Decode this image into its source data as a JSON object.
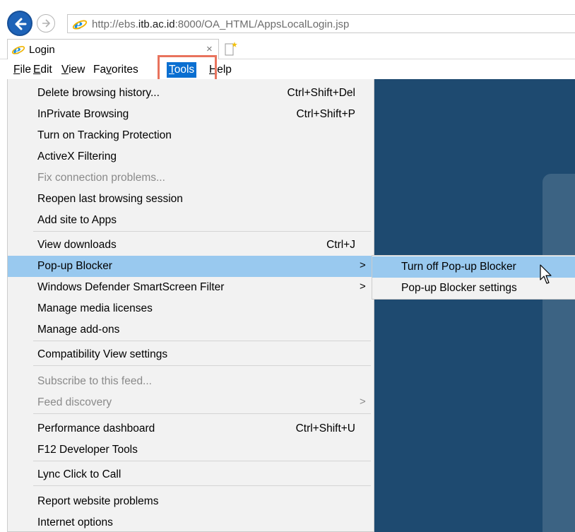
{
  "browser": {
    "url_prefix": "http://ebs.",
    "url_domain": "itb.ac.id",
    "url_suffix": ":8000/OA_HTML/AppsLocalLogin.jsp",
    "tab_title": "Login",
    "tab_close_glyph": "×",
    "icons": [
      "back-icon",
      "forward-icon",
      "ie-icon",
      "new-tab-icon"
    ]
  },
  "menubar": {
    "file": {
      "u": "F",
      "rest": "ile"
    },
    "edit": {
      "u": "E",
      "rest": "dit"
    },
    "view": {
      "u": "V",
      "rest": "iew"
    },
    "favorites": {
      "pre": "Fa",
      "u": "v",
      "rest": "orites"
    },
    "tools": {
      "u": "T",
      "rest": "ools"
    },
    "help": {
      "u": "H",
      "rest": "elp"
    },
    "active": "Tools"
  },
  "tools_menu": {
    "items": [
      {
        "label": "Delete browsing history...",
        "shortcut": "Ctrl+Shift+Del"
      },
      {
        "label": "InPrivate Browsing",
        "shortcut": "Ctrl+Shift+P"
      },
      {
        "label": "Turn on Tracking Protection"
      },
      {
        "label": "ActiveX Filtering"
      },
      {
        "label": "Fix connection problems...",
        "disabled": true
      },
      {
        "label": "Reopen last browsing session"
      },
      {
        "label": "Add site to Apps"
      },
      {
        "label": "View downloads",
        "shortcut": "Ctrl+J"
      },
      {
        "label": "Pop-up Blocker",
        "arrow": ">",
        "selected": true
      },
      {
        "label": "Windows Defender SmartScreen Filter",
        "arrow": ">"
      },
      {
        "label": "Manage media licenses"
      },
      {
        "label": "Manage add-ons"
      },
      {
        "label": "Compatibility View settings"
      },
      {
        "label": "Subscribe to this feed...",
        "disabled": true
      },
      {
        "label": "Feed discovery",
        "arrow": ">",
        "disabled": true
      },
      {
        "label": "Performance dashboard",
        "shortcut": "Ctrl+Shift+U"
      },
      {
        "label": "F12 Developer Tools"
      },
      {
        "label": "Lync Click to Call"
      },
      {
        "label": "Report website problems"
      },
      {
        "label": "Internet options"
      }
    ]
  },
  "popup_submenu": {
    "items": [
      {
        "label": "Turn off Pop-up Blocker",
        "selected": true
      },
      {
        "label": "Pop-up Blocker settings"
      }
    ]
  },
  "colors": {
    "menu_bg": "#f2f2f2",
    "selection": "#99c9ef",
    "tools_active": "#0a6fd1",
    "highlight_box": "#e8735d",
    "page_dark": "#1e4a70"
  }
}
